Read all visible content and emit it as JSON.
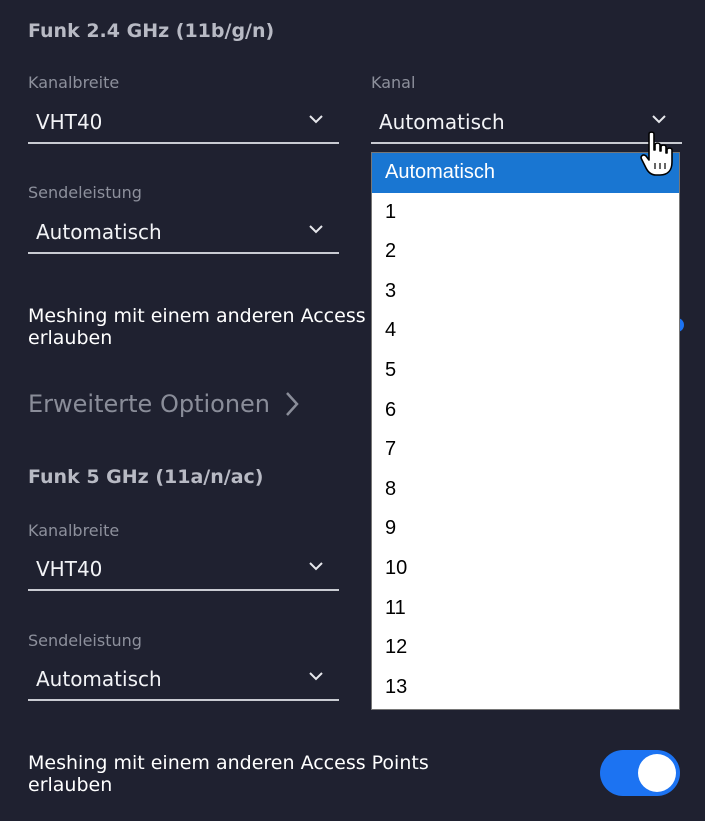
{
  "section1": {
    "title": "Funk 2.4 GHz (11b/g/n)",
    "kanalbreite": {
      "label": "Kanalbreite",
      "value": "VHT40"
    },
    "kanal": {
      "label": "Kanal",
      "value": "Automatisch"
    },
    "sendeleistung": {
      "label": "Sendeleistung",
      "value": "Automatisch"
    },
    "meshing": {
      "line1": "Meshing mit einem anderen Access",
      "line2": "erlauben"
    }
  },
  "erweiterte_optionen": "Erweiterte Optionen",
  "section2": {
    "title": "Funk 5 GHz (11a/n/ac)",
    "kanalbreite": {
      "label": "Kanalbreite",
      "value": "VHT40"
    },
    "sendeleistung": {
      "label": "Sendeleistung",
      "value": "Automatisch"
    },
    "meshing": {
      "line1": "Meshing mit einem anderen Access Points",
      "line2": "erlauben",
      "toggle_on": true
    }
  },
  "kanal_dropdown": {
    "selected": "Automatisch",
    "options": [
      "Automatisch",
      "1",
      "2",
      "3",
      "4",
      "5",
      "6",
      "7",
      "8",
      "9",
      "10",
      "11",
      "12",
      "13"
    ]
  },
  "colors": {
    "background": "#1f2130",
    "accent": "#1c73f2",
    "selected_option": "#1976d2"
  }
}
